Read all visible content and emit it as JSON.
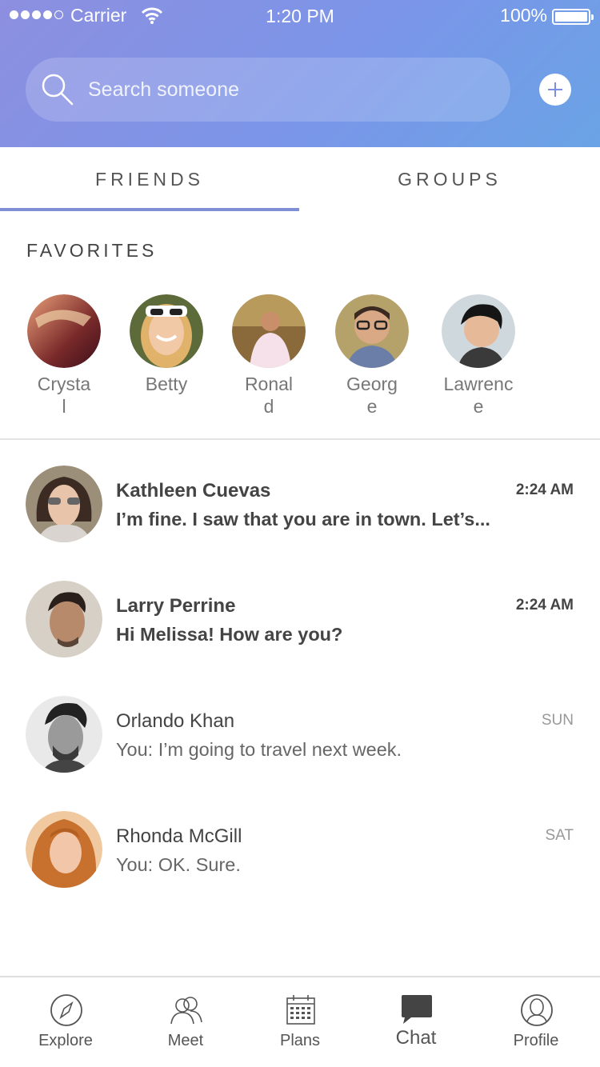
{
  "status_bar": {
    "carrier": "Carrier",
    "time": "1:20 PM",
    "battery": "100%",
    "battery_level": 1.0
  },
  "header": {
    "search_placeholder": "Search someone",
    "add_icon": "plus-icon"
  },
  "tabs": [
    {
      "label": "FRIENDS",
      "active": true
    },
    {
      "label": "GROUPS",
      "active": false
    }
  ],
  "favorites": {
    "title": "FAVORITES",
    "items": [
      {
        "name": "Crystal"
      },
      {
        "name": "Betty"
      },
      {
        "name": "Ronald"
      },
      {
        "name": "George"
      },
      {
        "name": "Lawrence"
      }
    ]
  },
  "chats": [
    {
      "name": "Kathleen Cuevas",
      "message": "I’m fine. I saw that you are in town. Let’s...",
      "time": "2:24 AM",
      "unread": true
    },
    {
      "name": "Larry Perrine",
      "message": "Hi Melissa! How are you?",
      "time": "2:24 AM",
      "unread": true
    },
    {
      "name": "Orlando Khan",
      "message": "You: I’m going to travel next week.",
      "time": "SUN",
      "unread": false
    },
    {
      "name": "Rhonda McGill",
      "message": "You: OK. Sure.",
      "time": "SAT",
      "unread": false
    }
  ],
  "nav": [
    {
      "label": "Explore",
      "icon": "compass-icon"
    },
    {
      "label": "Meet",
      "icon": "people-icon"
    },
    {
      "label": "Plans",
      "icon": "calendar-icon"
    },
    {
      "label": "Chat",
      "icon": "chat-bubble-icon",
      "active": true
    },
    {
      "label": "Profile",
      "icon": "profile-icon"
    }
  ],
  "colors": {
    "accent": "#7f8fd6",
    "header_start": "#8d8fe0",
    "header_end": "#6aa3e6"
  }
}
